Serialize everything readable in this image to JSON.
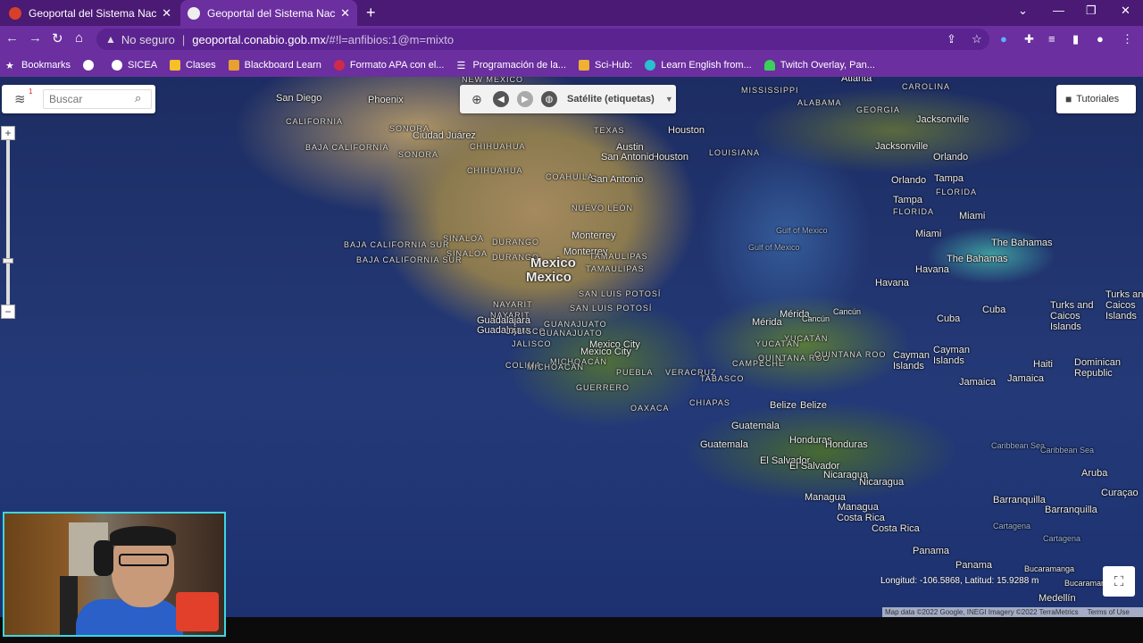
{
  "tabs": [
    {
      "label": "Geoportal del Sistema Nacional d",
      "active": false
    },
    {
      "label": "Geoportal del Sistema Nacional d",
      "active": true
    }
  ],
  "address": {
    "security": "No seguro",
    "separator": "|",
    "host": "geoportal.conabio.gob.mx",
    "path": "/#!l=anfibios:1@m=mixto"
  },
  "bookmarks": [
    {
      "label": "Bookmarks",
      "icon": "star-icon"
    },
    {
      "label": "",
      "icon": "globe-icon"
    },
    {
      "label": "SICEA",
      "icon": "globe-icon"
    },
    {
      "label": "Clases",
      "icon": "classroom-icon"
    },
    {
      "label": "Blackboard Learn",
      "icon": "blackboard-icon"
    },
    {
      "label": "Formato APA con el...",
      "icon": "apa-icon"
    },
    {
      "label": "Programación de la...",
      "icon": "list-icon"
    },
    {
      "label": "Sci-Hub:",
      "icon": "scihub-icon"
    },
    {
      "label": "Learn English from...",
      "icon": "english-icon"
    },
    {
      "label": "Twitch Overlay, Pan...",
      "icon": "twitch-icon"
    }
  ],
  "search": {
    "placeholder": "Buscar",
    "layer_badge": "1"
  },
  "toolbar": {
    "layer_label": "Satélite (etiquetas)"
  },
  "tutoriales": {
    "label": "Tutoriales"
  },
  "coords": {
    "text": "Longitud: -106.5868, Latitud: 15.9288 m"
  },
  "attribution": {
    "map_data": "Map data ©2022 Google, INEGI Imagery ©2022 TerraMetrics",
    "terms": "Terms of Use"
  },
  "labels": {
    "san_diego": "San Diego",
    "phoenix": "Phoenix",
    "new_mexico": "NEW MEXICO",
    "mississippi": "MISSISSIPPI",
    "alabama": "ALABAMA",
    "georgia": "GEORGIA",
    "carolina": "CAROLINA",
    "atlanta": "Atlanta",
    "jacksonville": "Jacksonville",
    "ciudad_juarez": "Ciudad Juárez",
    "chihuahua": "CHIHUAHUA",
    "texas": "TEXAS",
    "houston": "Houston",
    "louisiana": "LOUISIANA",
    "austin": "Austin",
    "san_antonio": "San Antonio",
    "sonora": "SONORA",
    "california": "CALIFORNIA",
    "baja_california": "BAJA CALIFORNIA",
    "coahuila": "COAHUILA",
    "nuevo_leon": "NUEVO LEÓN",
    "orlando": "Orlando",
    "tampa": "Tampa",
    "florida": "FLORIDA",
    "miami": "Miami",
    "monterrey": "Monterrey",
    "tamaulipas": "TAMAULIPAS",
    "sinaloa": "SINALOA",
    "durango": "DURANGO",
    "gulf_of_mexico": "Gulf of Mexico",
    "mexico": "Mexico",
    "baja_california_sur": "BAJA CALIFORNIA SUR",
    "the_bahamas": "The Bahamas",
    "havana": "Havana",
    "san_luis_potosi": "SAN LUIS POTOSÍ",
    "nayarit": "NAYARIT",
    "guadalajara": "Guadalajara",
    "jalisco": "JALISCO",
    "guanajuato": "GUANAJUATO",
    "merida": "Mérida",
    "cancun": "Cancún",
    "yucatan": "YUCATÁN",
    "cuba": "Cuba",
    "turks_caicos": "Turks and Caicos Islands",
    "mexico_city": "Mexico City",
    "colima": "COLIMA",
    "michoacan": "MICHOACÁN",
    "campeche": "CAMPECHE",
    "quintana_roo": "QUINTANA ROO",
    "cayman": "Cayman Islands",
    "haiti": "Haiti",
    "dominican": "Dominican Republic",
    "puebla": "PUEBLA",
    "veracruz": "VERACRUZ",
    "tabasco": "TABASCO",
    "guerrero": "GUERRERO",
    "jamaica": "Jamaica",
    "oaxaca": "OAXACA",
    "chiapas": "CHIAPAS",
    "belize": "Belize",
    "guatemala": "Guatemala",
    "honduras": "Honduras",
    "caribbean_sea": "Caribbean Sea",
    "el_salvador": "El Salvador",
    "nicaragua": "Nicaragua",
    "aruba": "Aruba",
    "curacao": "Curaçao",
    "managua": "Managua",
    "barranquilla": "Barranquilla",
    "cartagena": "Cartagena",
    "costa_rica": "Costa Rica",
    "panama": "Panama",
    "bucaramanga": "Bucaramanga",
    "medellin": "Medellín"
  },
  "colors": {
    "tabbar": "#4a1a74",
    "chrome": "#6b2fa0",
    "webcam_border": "#3dd6e0"
  }
}
